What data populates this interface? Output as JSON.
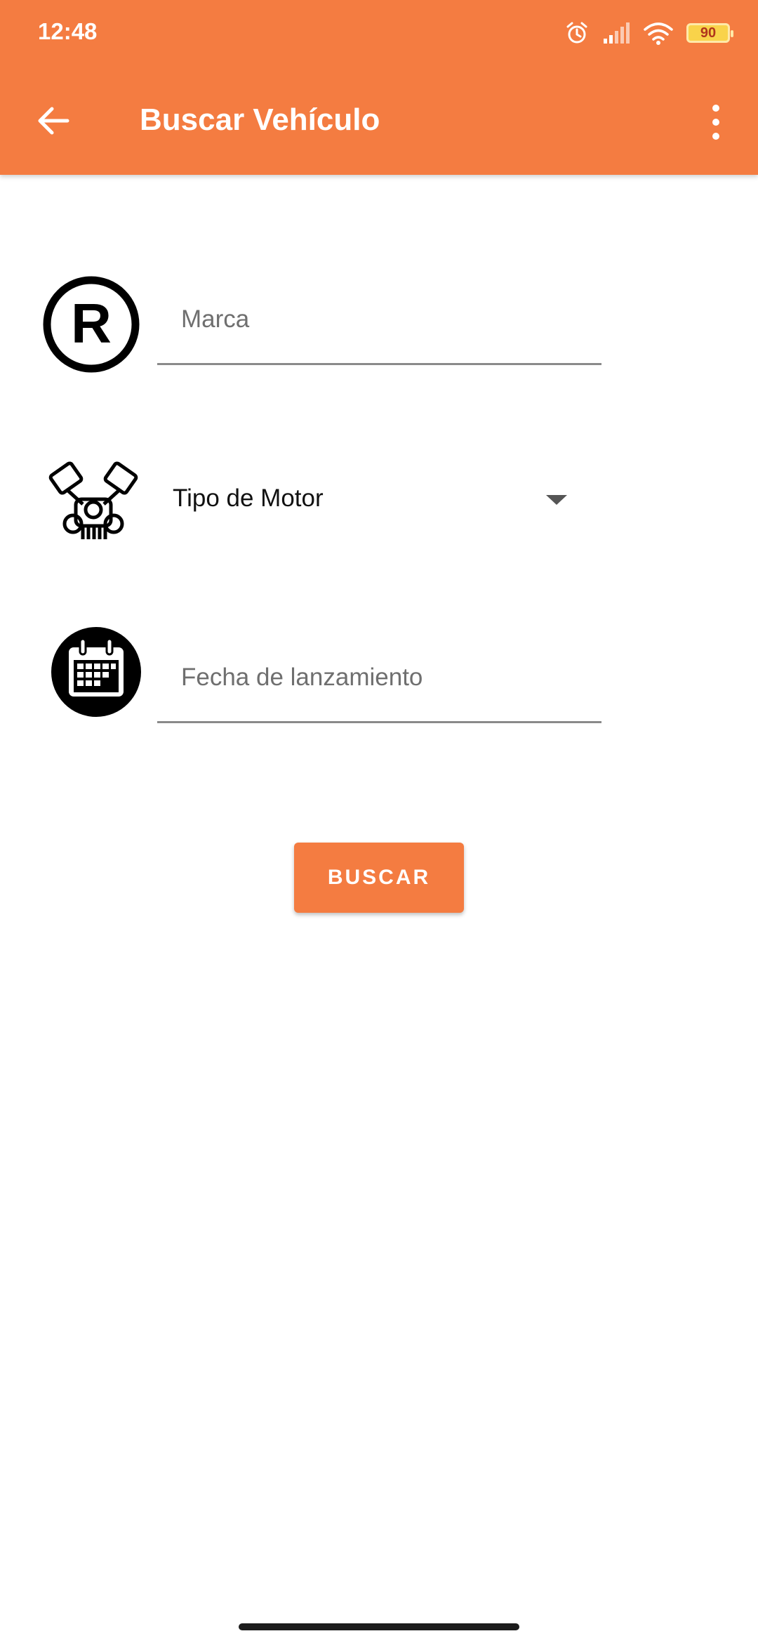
{
  "status_bar": {
    "time": "12:48",
    "battery": "90",
    "icons": [
      "alarm-icon",
      "signal-icon",
      "wifi-icon",
      "battery-icon"
    ]
  },
  "app_bar": {
    "title": "Buscar Vehículo",
    "back_icon": "arrow-left-icon",
    "menu_icon": "more-vert-icon",
    "color": "#f47c41"
  },
  "form": {
    "marca": {
      "placeholder": "Marca",
      "value": "",
      "icon": "registered-icon"
    },
    "motor": {
      "selected": "Tipo de Motor",
      "icon": "engine-icon"
    },
    "fecha": {
      "placeholder": "Fecha de lanzamiento",
      "value": "",
      "icon": "calendar-icon"
    }
  },
  "actions": {
    "buscar_label": "BUSCAR"
  }
}
